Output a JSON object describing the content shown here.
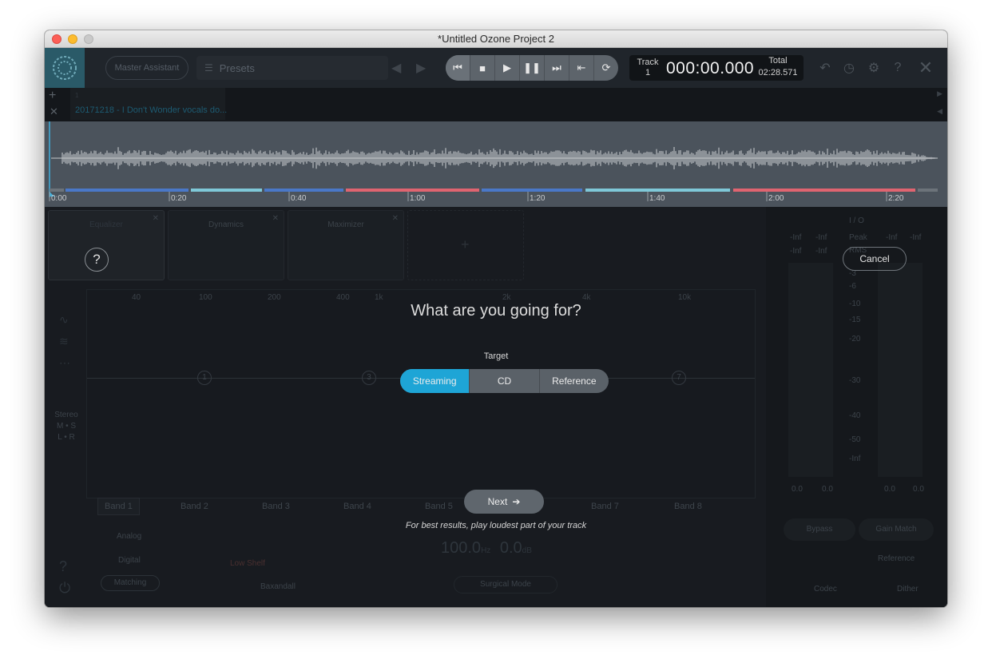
{
  "window": {
    "title": "*Untitled Ozone Project 2"
  },
  "toolbar": {
    "master_assistant_label": "Master Assistant",
    "presets_label": "Presets",
    "track_label": "Track",
    "track_number": "1",
    "time": "000:00.000",
    "total_label": "Total",
    "total_time": "02:28.571"
  },
  "tabs": {
    "file_number": "1",
    "file_name": "20171218 - I Don't Wonder vocals do..."
  },
  "timeline": {
    "ticks": [
      "0:00",
      "0:20",
      "0:40",
      "1:00",
      "1:20",
      "1:40",
      "2:00",
      "2:20"
    ],
    "segment_colors": [
      "#4a78c8",
      "#7fc8d8",
      "#e06470"
    ]
  },
  "modules": {
    "module1": "Equalizer",
    "module2": "Dynamics",
    "module3": "Maximizer"
  },
  "eq": {
    "freq_labels": [
      "40",
      "100",
      "200",
      "400",
      "1k",
      "2k",
      "4k",
      "10k"
    ],
    "nodes": [
      "1",
      "3",
      "7"
    ],
    "stereo_label": "Stereo",
    "ms_label": "M • S",
    "lr_label": "L • R",
    "bands": [
      "Band 1",
      "Band 2",
      "Band 3",
      "Band 4",
      "Band 5",
      "Band 6",
      "Band 7",
      "Band 8"
    ],
    "analog_label": "Analog",
    "digital_label": "Digital",
    "matching_label": "Matching",
    "filter_label": "Low Shelf",
    "baxandall_label": "Baxandall",
    "freq_value": "100.0",
    "freq_unit": "Hz",
    "gain_value": "0.0",
    "gain_unit": "dB",
    "surgical_label": "Surgical Mode"
  },
  "meters": {
    "io_label": "I / O",
    "peak_label": "Peak",
    "rms_label": "RMS",
    "neg_inf": "-Inf",
    "scale": [
      "-3",
      "-6",
      "-10",
      "-15",
      "-20",
      "-30",
      "-40",
      "-50",
      "-Inf"
    ],
    "readout": "0.0",
    "bypass_label": "Bypass",
    "gain_match_label": "Gain Match",
    "reference_label": "Reference",
    "codec_label": "Codec",
    "dither_label": "Dither"
  },
  "assistant": {
    "heading": "What are you going for?",
    "target_label": "Target",
    "options": [
      "Streaming",
      "CD",
      "Reference"
    ],
    "selected": "Streaming",
    "next_label": "Next",
    "hint": "For best results, play loudest part of your track",
    "cancel_label": "Cancel",
    "help_symbol": "?"
  },
  "colors": {
    "accent": "#1ea5d6"
  }
}
